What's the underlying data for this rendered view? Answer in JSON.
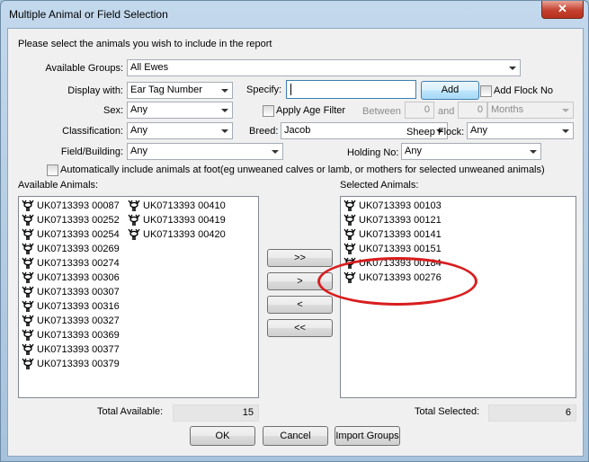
{
  "window": {
    "title": "Multiple Animal or Field Selection",
    "close_glyph": "✕"
  },
  "prompt": "Please select the animals you wish to include in the report",
  "available_groups": {
    "label": "Available Groups:",
    "value": "All Ewes"
  },
  "display_with": {
    "label": "Display with:",
    "value": "Ear Tag Number"
  },
  "specify": {
    "label": "Specify:",
    "value": ""
  },
  "add_button": "Add",
  "add_flock_no": "Add Flock No",
  "sex": {
    "label": "Sex:",
    "value": "Any"
  },
  "apply_age_filter": "Apply Age Filter",
  "between": {
    "label": "Between",
    "from": "0",
    "and_label": "and",
    "to": "0",
    "unit": "Months"
  },
  "classification": {
    "label": "Classification:",
    "value": "Any"
  },
  "breed": {
    "label": "Breed:",
    "value": "Jacob"
  },
  "sheep_flock": {
    "label": "Sheep Flock:",
    "value": "Any"
  },
  "field_building": {
    "label": "Field/Building:",
    "value": "Any"
  },
  "holding_no": {
    "label": "Holding No:",
    "value": "Any"
  },
  "auto_include": "Automatically include animals at foot(eg unweaned calves or lamb, or mothers for selected unweaned animals)",
  "available_animals": {
    "label": "Available Animals:",
    "col1": [
      "UK0713393 00087",
      "UK0713393 00252",
      "UK0713393 00254",
      "UK0713393 00269",
      "UK0713393 00274",
      "UK0713393 00306",
      "UK0713393 00307",
      "UK0713393 00316",
      "UK0713393 00327",
      "UK0713393 00369",
      "UK0713393 00377",
      "UK0713393 00379"
    ],
    "col2": [
      "UK0713393 00410",
      "UK0713393 00419",
      "UK0713393 00420"
    ]
  },
  "selected_animals": {
    "label": "Selected Animals:",
    "items": [
      "UK0713393 00103",
      "UK0713393 00121",
      "UK0713393 00141",
      "UK0713393 00151",
      "UK0713393 00184",
      "UK0713393 00276"
    ]
  },
  "move_buttons": {
    "add_all": ">>",
    "add": ">",
    "remove": "<",
    "remove_all": "<<"
  },
  "totals": {
    "available_label": "Total Available:",
    "available": "15",
    "selected_label": "Total Selected:",
    "selected": "6"
  },
  "footer": {
    "ok": "OK",
    "cancel": "Cancel",
    "import": "Import Groups"
  },
  "colors": {
    "annotation": "#d81e1e",
    "close": "#c4412f"
  }
}
